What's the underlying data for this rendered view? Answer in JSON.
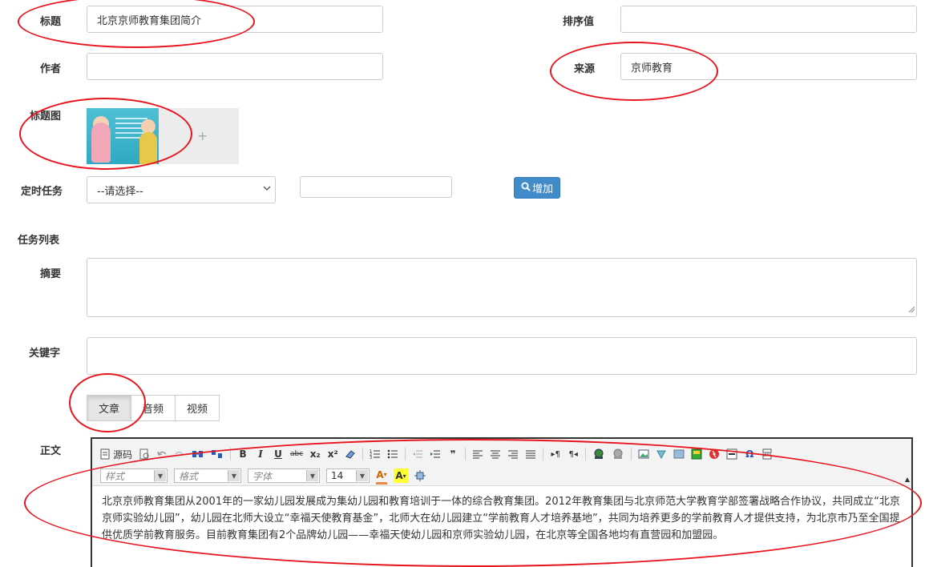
{
  "form": {
    "title_label": "标题",
    "title_value": "北京京师教育集团简介",
    "sort_label": "排序值",
    "sort_value": "",
    "author_label": "作者",
    "author_value": "",
    "source_label": "来源",
    "source_value": "京师教育",
    "title_image_label": "标题图",
    "add_image_symbol": "+",
    "scheduled_task_label": "定时任务",
    "scheduled_task_select": "--请选择--",
    "scheduled_task_input": "",
    "add_button_label": "增加",
    "task_list_label": "任务列表",
    "summary_label": "摘要",
    "summary_value": "",
    "keywords_label": "关键字",
    "keywords_value": "",
    "body_label": "正文"
  },
  "tabs": [
    {
      "label": "文章",
      "active": true
    },
    {
      "label": "音频",
      "active": false
    },
    {
      "label": "视频",
      "active": false
    }
  ],
  "editor": {
    "source_label": "源码",
    "style_placeholder": "样式",
    "format_placeholder": "格式",
    "font_placeholder": "字体",
    "size_value": "14",
    "bold": "B",
    "italic": "I",
    "underline": "U",
    "strike": "abc",
    "subscript": "x₂",
    "superscript": "x²",
    "quote": "❞",
    "content": "北京京师教育集团从2001年的一家幼儿园发展成为集幼儿园和教育培训于一体的综合教育集团。2012年教育集团与北京师范大学教育学部签署战略合作协议，共同成立“北京京师实验幼儿园”，幼儿园在北师大设立“幸福天使教育基金”，北师大在幼儿园建立“学前教育人才培养基地”，共同为培养更多的学前教育人才提供支持，为北京市乃至全国提供优质学前教育服务。目前教育集团有2个品牌幼儿园——幸福天使幼儿园和京师实验幼儿园，在北京等全国各地均有直营园和加盟园。"
  },
  "colors": {
    "annotation": "#e8141e",
    "primary_button": "#428bca",
    "border": "#cccccc"
  }
}
